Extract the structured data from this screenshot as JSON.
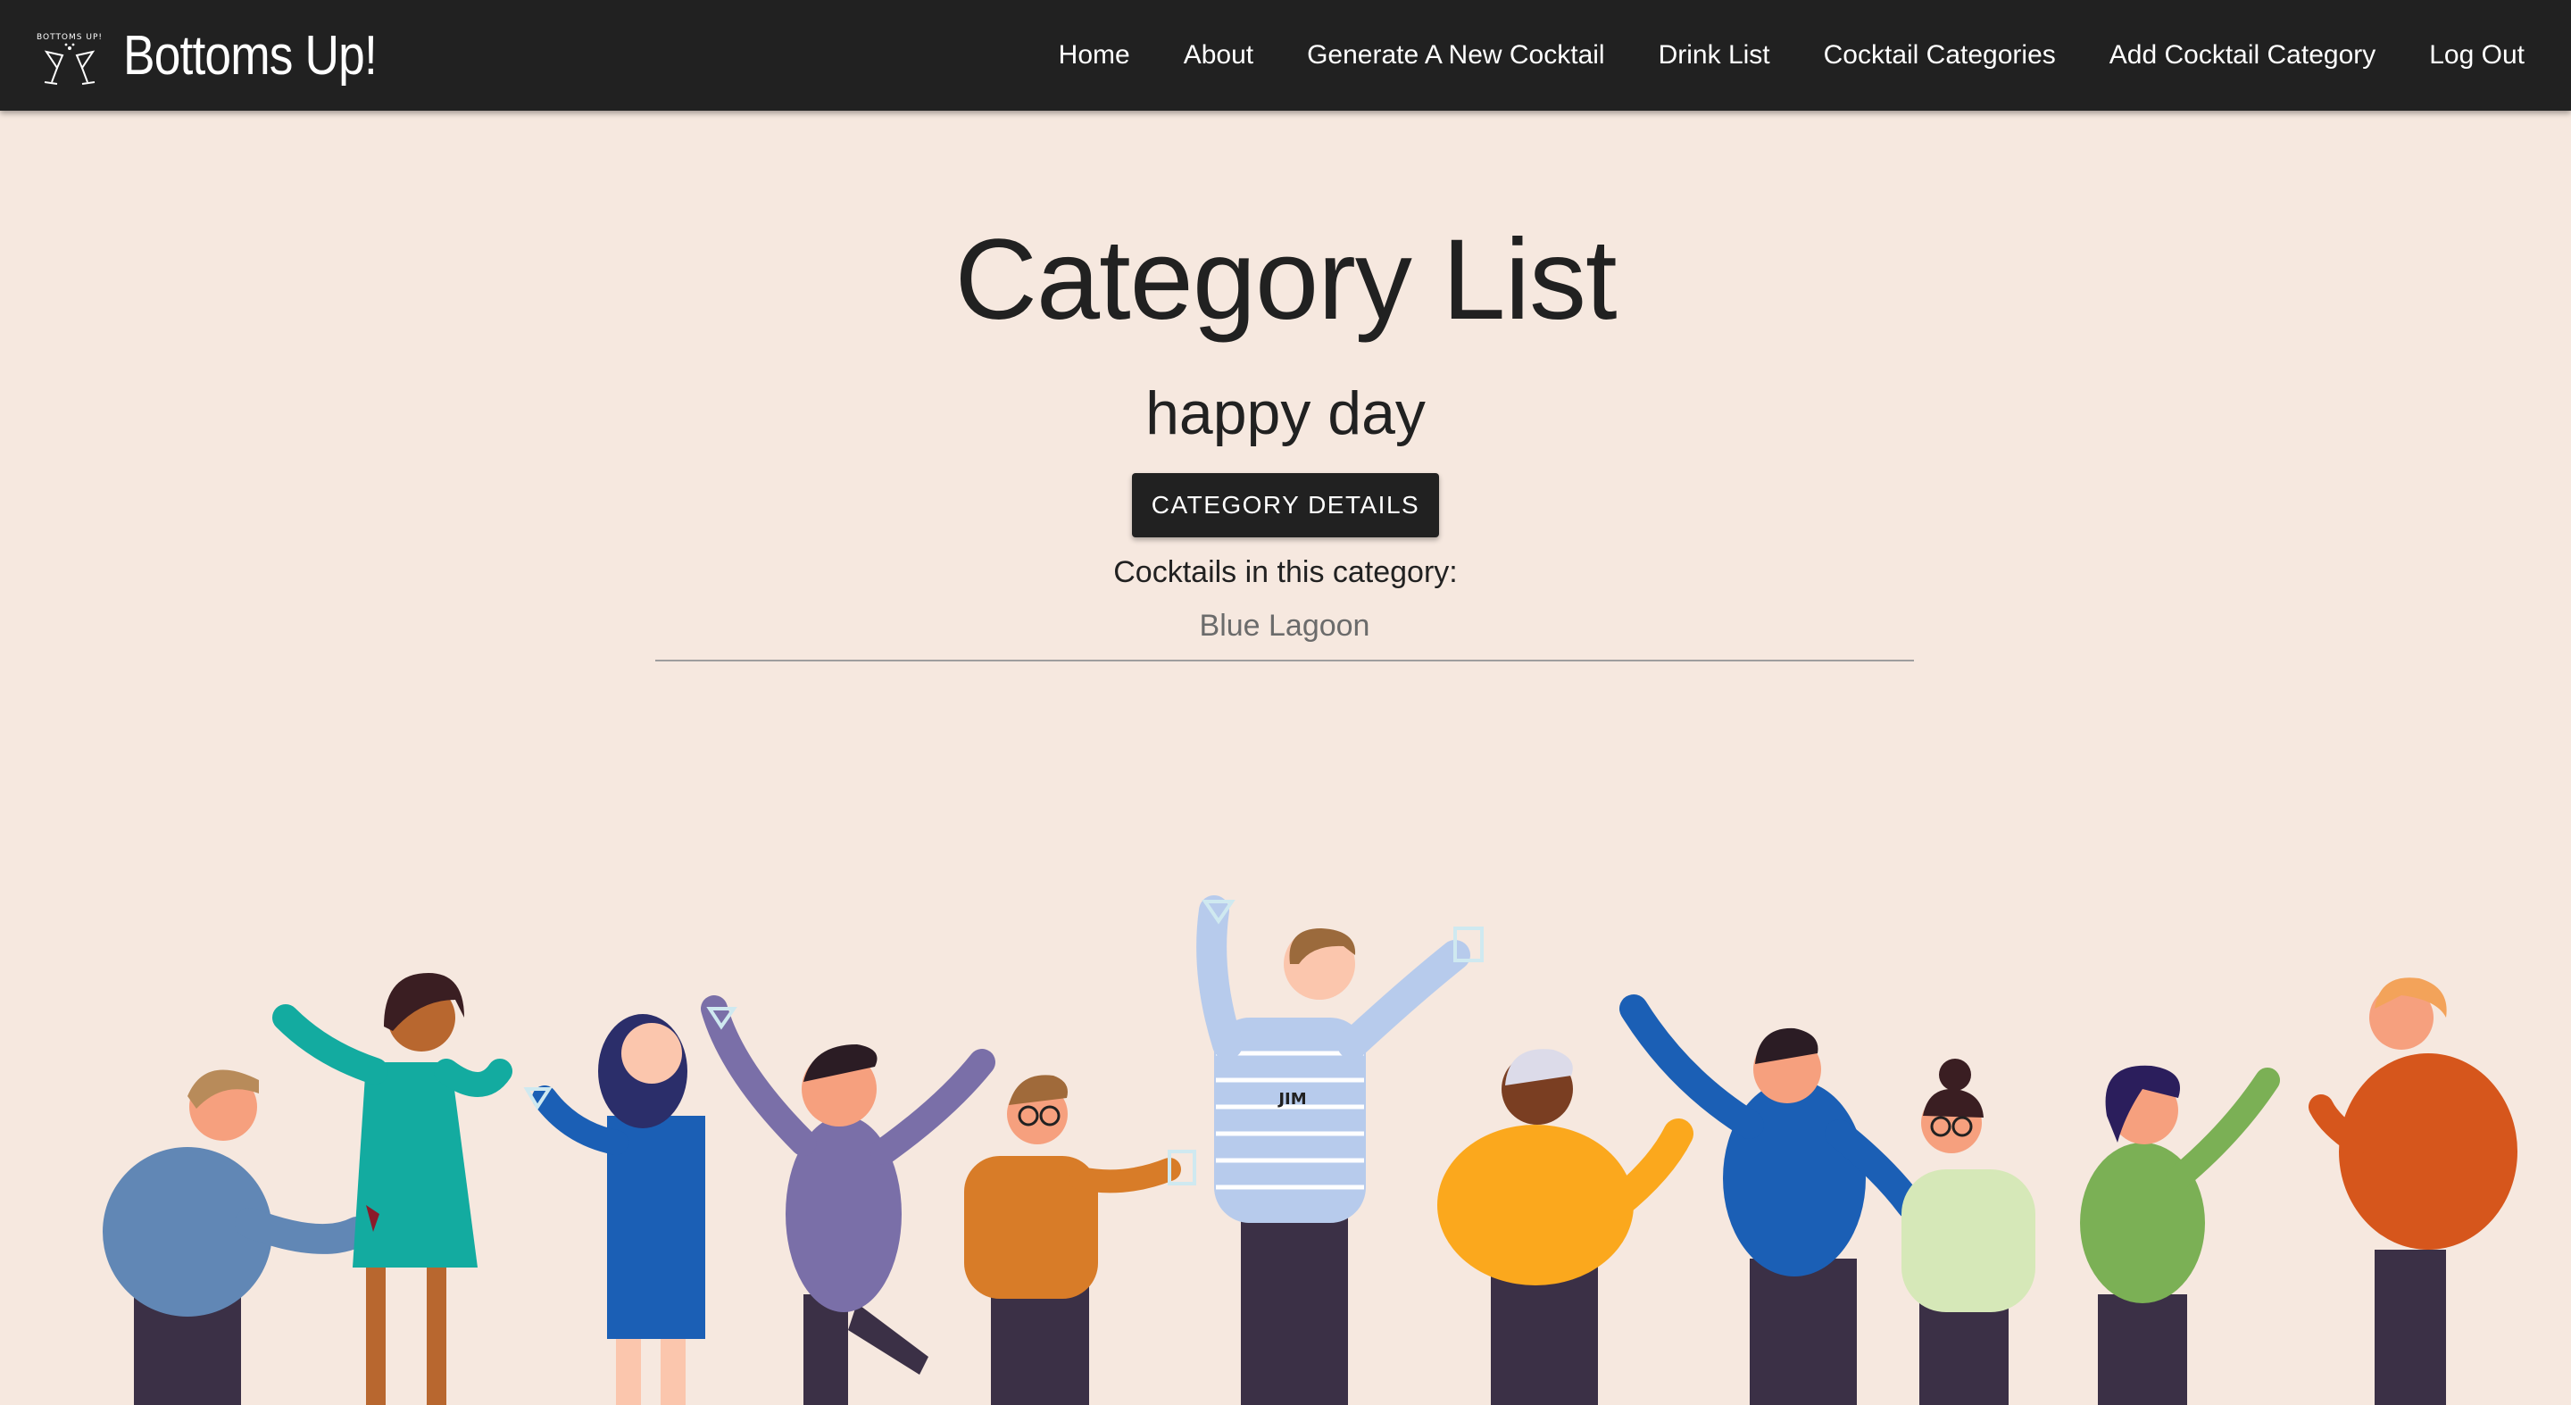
{
  "app": {
    "title": "Bottoms Up!",
    "logo_icon": "clinking-glasses-logo-icon",
    "logo_text": "BOTTOMS UP!"
  },
  "nav": {
    "items": [
      {
        "label": "Home"
      },
      {
        "label": "About"
      },
      {
        "label": "Generate A New Cocktail"
      },
      {
        "label": "Drink List"
      },
      {
        "label": "Cocktail Categories"
      },
      {
        "label": "Add Cocktail Category"
      },
      {
        "label": "Log Out"
      }
    ]
  },
  "page": {
    "title": "Category List",
    "category_name": "happy day",
    "details_button": "CATEGORY DETAILS",
    "cocktails_label": "Cocktails in this category:",
    "cocktails": [
      "Blue Lagoon"
    ]
  },
  "illustration": {
    "name_tag": "JIM"
  },
  "colors": {
    "background": "#f6e8df",
    "navbar": "#212121",
    "button": "#212121",
    "text": "#212121",
    "muted_text": "#6b6b6b"
  }
}
